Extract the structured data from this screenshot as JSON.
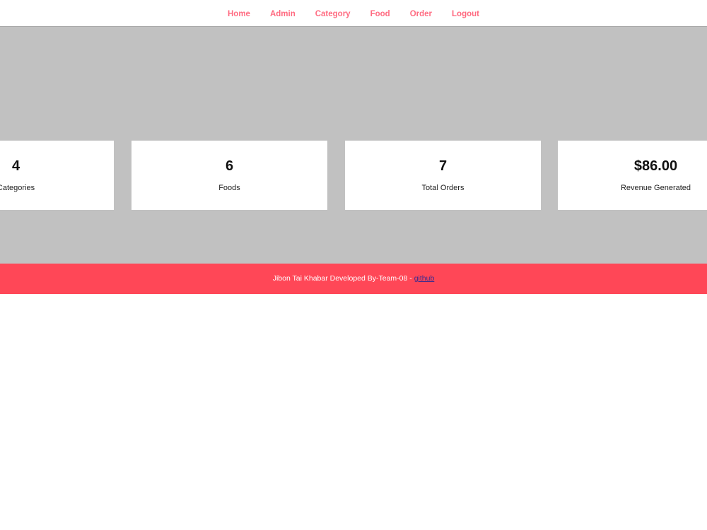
{
  "nav": {
    "items": [
      "Home",
      "Admin",
      "Category",
      "Food",
      "Order",
      "Logout"
    ]
  },
  "stats": [
    {
      "value": "4",
      "label": "Categories"
    },
    {
      "value": "6",
      "label": "Foods"
    },
    {
      "value": "7",
      "label": "Total Orders"
    },
    {
      "value": "$86.00",
      "label": "Revenue Generated"
    }
  ],
  "footer": {
    "text": "Jibon Tai Khabar Developed By-Team-08 - ",
    "link_label": "github"
  },
  "colors": {
    "nav_link": "#ff6b81",
    "main_bg": "#c1c1c1",
    "footer_bg": "#ff4757"
  }
}
